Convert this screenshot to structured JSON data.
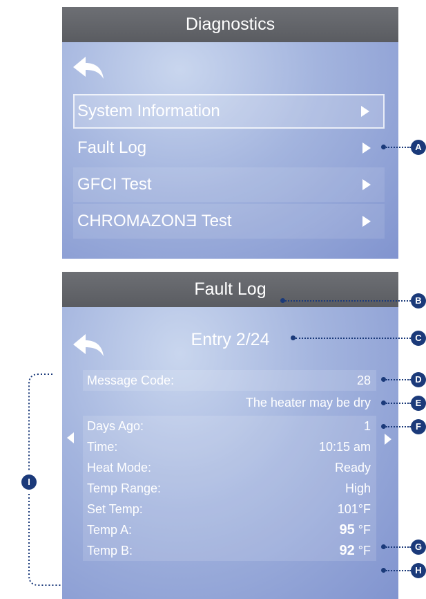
{
  "screen1": {
    "title": "Diagnostics",
    "menu": [
      {
        "label": "System Information"
      },
      {
        "label": "Fault Log"
      },
      {
        "label": "GFCI Test"
      },
      {
        "label": "CHROMAZONƎ Test"
      }
    ]
  },
  "screen2": {
    "title": "Fault Log",
    "entry": "Entry 2/24",
    "message_code_label": "Message Code:",
    "message_code_value": "28",
    "message_text": "The heater may be dry",
    "rows": [
      {
        "label": "Days Ago:",
        "value": "1"
      },
      {
        "label": "Time:",
        "value": "10:15 am"
      },
      {
        "label": "Heat Mode:",
        "value": "Ready"
      },
      {
        "label": "Temp Range:",
        "value": "High"
      },
      {
        "label": "Set Temp:",
        "value": "101°F"
      }
    ],
    "temp_a_label": "Temp A:",
    "temp_a_value": "95",
    "temp_b_label": "Temp B:",
    "temp_b_value": "92",
    "temp_unit": "°F"
  },
  "callouts": {
    "a": "A",
    "b": "B",
    "c": "C",
    "d": "D",
    "e": "E",
    "f": "F",
    "g": "G",
    "h": "H",
    "i": "I"
  },
  "colors": {
    "titlebar": "#616368",
    "screen_gradient_light": "#c9d6ee",
    "screen_gradient_dark": "#8194cf",
    "callout": "#1b3a7a"
  },
  "icons": {
    "back": "back-arrow-icon",
    "next": "triangle-right-icon",
    "prev": "triangle-left-icon"
  }
}
